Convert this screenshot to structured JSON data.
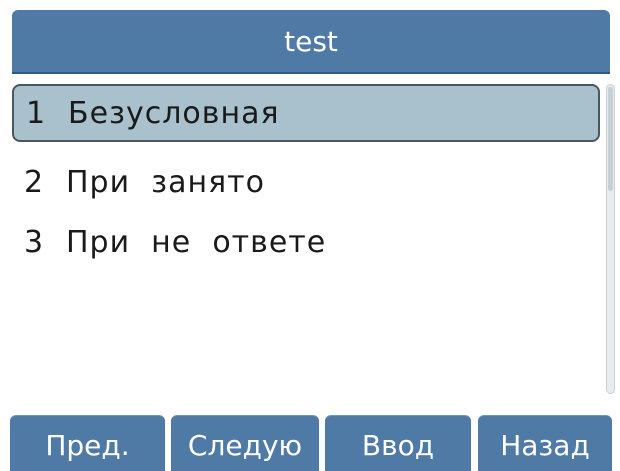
{
  "header": {
    "title": "test"
  },
  "menu": {
    "items": [
      {
        "number": "1",
        "label": "Безусловная",
        "selected": true
      },
      {
        "number": "2",
        "label": "При  занято",
        "selected": false
      },
      {
        "number": "3",
        "label": "При  не  ответе",
        "selected": false
      }
    ]
  },
  "softkeys": {
    "prev": "Пред.",
    "next": "Следую",
    "enter": "Ввод",
    "back": "Назад"
  },
  "colors": {
    "title_bar": "#4f7aa5",
    "selected_item": "#a9c1cc",
    "softkey": "#4f7aa5"
  }
}
